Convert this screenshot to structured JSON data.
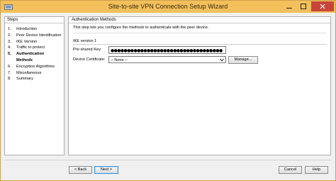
{
  "window": {
    "title": "Site-to-site VPN Connection Setup Wizard",
    "minimize_glyph": "minimize",
    "maximize_glyph": "maximize",
    "close_glyph": "close"
  },
  "steps_panel": {
    "header": "Steps",
    "items": [
      {
        "num": "1.",
        "label": "Introduction",
        "bold": false
      },
      {
        "num": "2.",
        "label": "Peer Device Identification",
        "bold": false
      },
      {
        "num": "3.",
        "label": "IKE Version",
        "bold": false
      },
      {
        "num": "4.",
        "label": "Traffic to protect",
        "bold": false
      },
      {
        "num": "5.",
        "label": "Authentication",
        "label2": "Methods",
        "bold": true
      },
      {
        "num": "6.",
        "label": "Encryption Algorithms",
        "bold": false
      },
      {
        "num": "7.",
        "label": "Miscellaneous",
        "bold": false
      },
      {
        "num": "8.",
        "label": "Summary",
        "bold": false
      }
    ]
  },
  "content": {
    "header": "Authentication Methods",
    "description": "This step lets you configure the methods to authenticate with the peer device.",
    "section_title": "IKE version 1",
    "psk_label": "Pre-shared Key:",
    "psk_value": "●●●●●●●●●●●●●●●●●●●●●●●●●●●●●●●●●●",
    "cert_label": "Device Certificate:",
    "cert_value": "-- None --",
    "manage_label": "Manage..."
  },
  "footer": {
    "back_label": "< Back",
    "next_label": "Next >",
    "cancel_label": "Cancel",
    "help_label": "Help"
  },
  "colors": {
    "titlebar": "#f3c05c",
    "close_button": "#c7443a",
    "default_button_border": "#3b8ed5"
  }
}
